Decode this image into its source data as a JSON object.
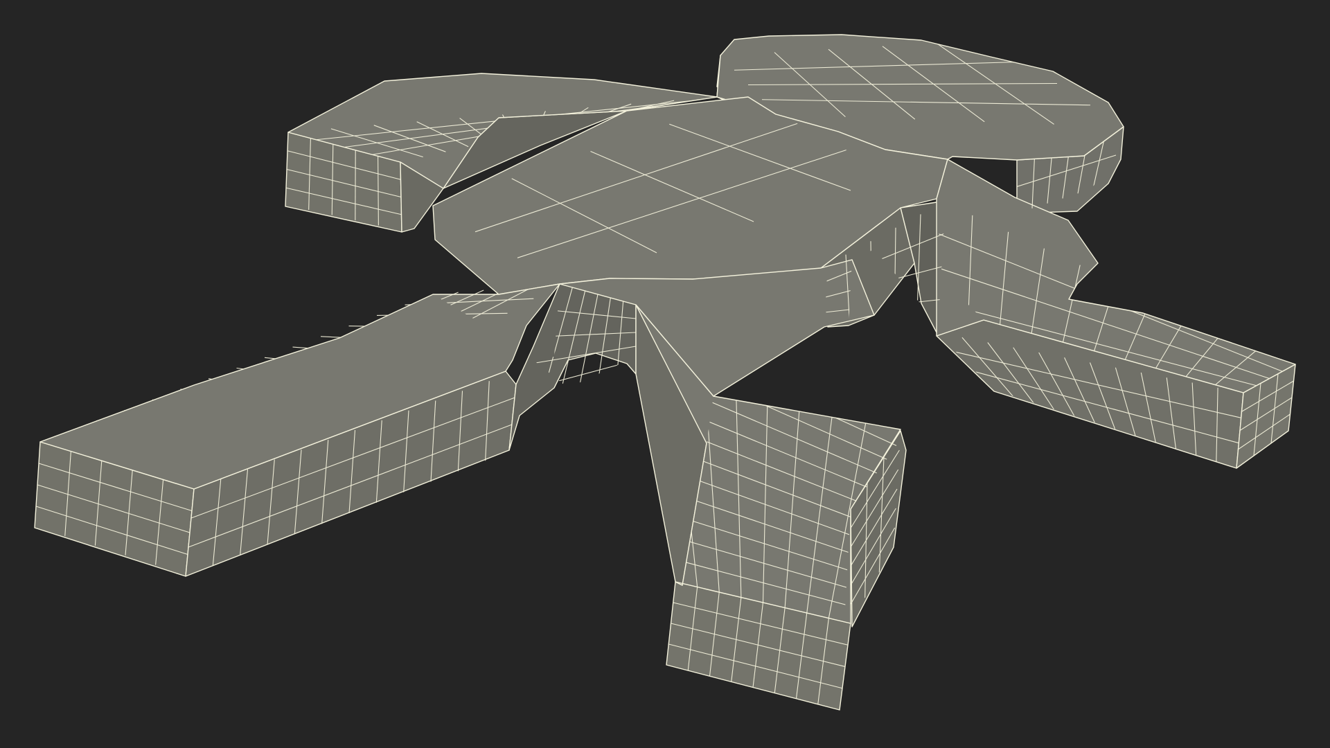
{
  "scene": {
    "background_color": "#252525",
    "model": {
      "subject": "human-figure-silhouette-block",
      "render_mode": "wireframe-over-shaded",
      "top_face_color": "#787870",
      "side_face_color": "#717168",
      "dark_side_color": "#5f5f58",
      "wire_color": "#f4f2dc",
      "parts": [
        "head",
        "torso",
        "left-arm",
        "right-arm",
        "left-leg",
        "right-leg"
      ]
    }
  }
}
